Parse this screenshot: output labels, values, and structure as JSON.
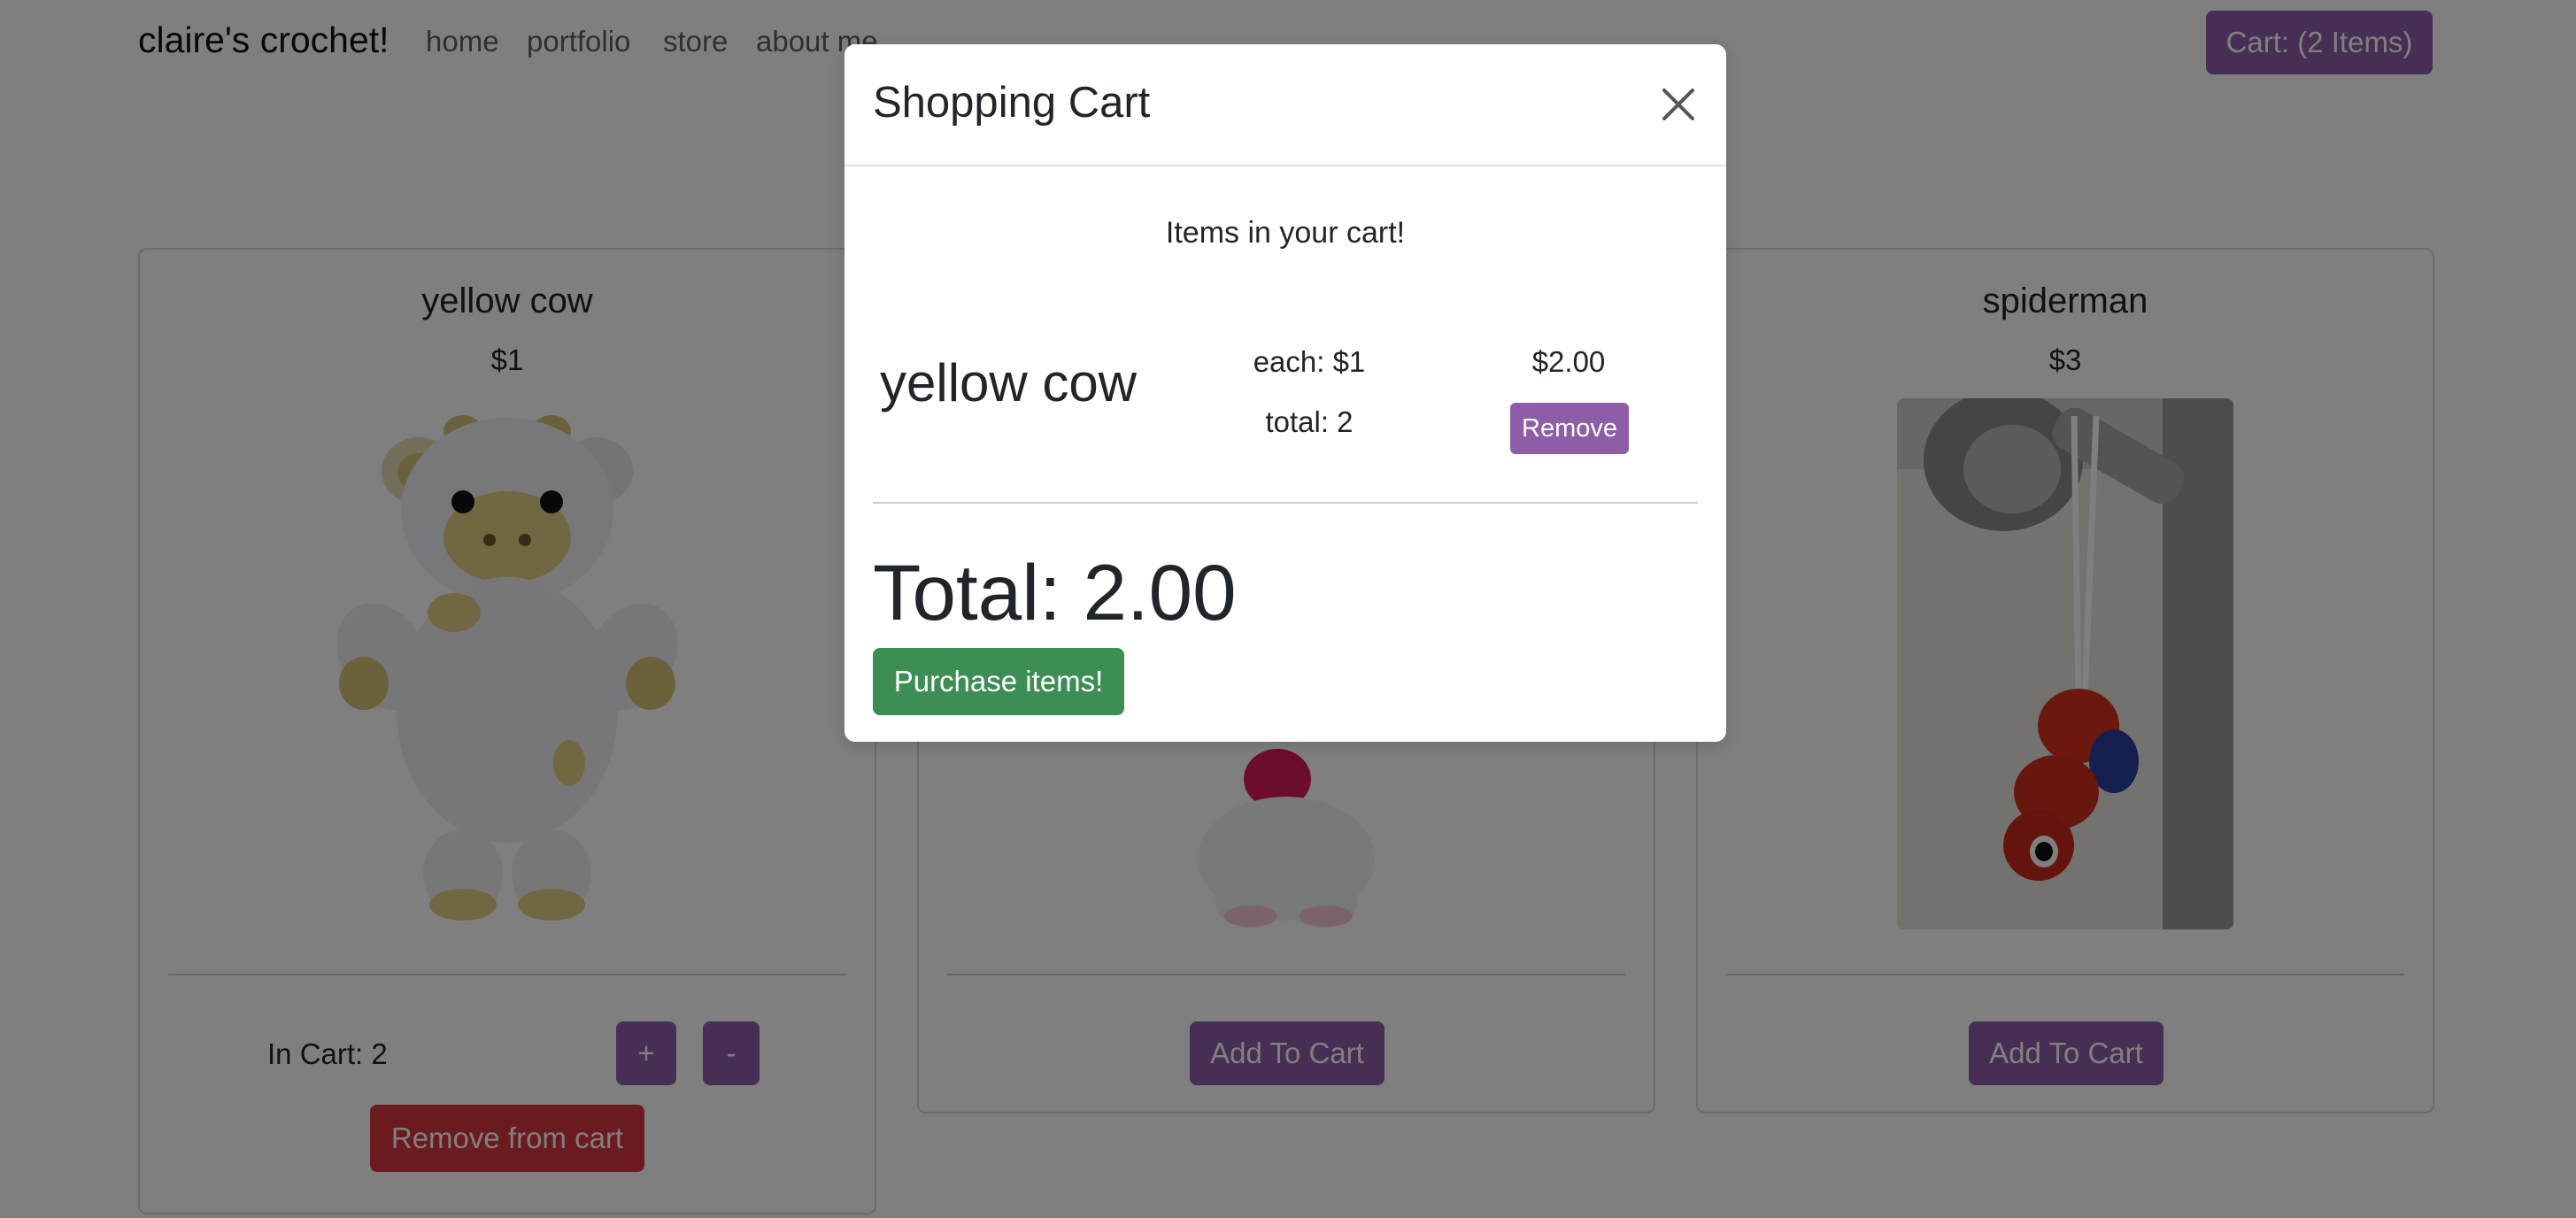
{
  "navbar": {
    "brand": "claire's crochet!",
    "links": [
      "home",
      "portfolio",
      "store",
      "about me"
    ],
    "cart_button": "Cart: (2 Items)"
  },
  "products": [
    {
      "name": "yellow cow",
      "price": "$1",
      "in_cart_label": "In Cart: 2",
      "plus_label": "+",
      "minus_label": "-",
      "remove_label": "Remove from cart"
    },
    {
      "name": "",
      "price": "",
      "add_label": "Add To Cart"
    },
    {
      "name": "spiderman",
      "price": "$3",
      "add_label": "Add To Cart"
    }
  ],
  "modal": {
    "title": "Shopping Cart",
    "intro": "Items in your cart!",
    "items": [
      {
        "name": "yellow cow",
        "each": "each: $1",
        "quantity": "total: 2",
        "subtotal": "$2.00",
        "remove_label": "Remove"
      }
    ],
    "total": "Total: 2.00",
    "purchase_label": "Purchase items!"
  },
  "colors": {
    "accent_purple": "#8e5da8",
    "danger_red": "#d63440",
    "success_green": "#3c8e54"
  }
}
